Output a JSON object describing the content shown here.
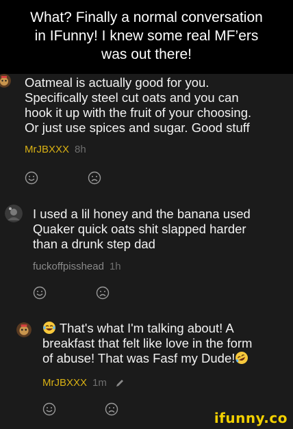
{
  "caption": {
    "lines": [
      "What? Finally a normal conversation",
      "in IFunny! I knew some real MF’ers",
      "was out there!"
    ]
  },
  "comments": [
    {
      "lines": [
        "Oatmeal is actually good for you.",
        "Specifically steel cut oats and you can",
        "hook it up with the fruit of your choosing.",
        "Or just use spices and sugar. Good stuff"
      ],
      "author": "MrJBXXX",
      "time": "8h",
      "avatar_icon": "bear-avatar-icon"
    },
    {
      "lines": [
        "I used a lil honey and the banana used",
        "Quaker quick oats shit slapped harder",
        "than a drunk step dad"
      ],
      "author": "fuckoffpisshead",
      "time": "1h",
      "avatar_icon": "dark-avatar-icon"
    },
    {
      "lines": [
        "That's what I'm talking about! A",
        "breakfast that felt like love in the form",
        "of abuse! That was Fasf my Dude!"
      ],
      "author": "MrJBXXX",
      "time": "1m",
      "avatar_icon": "bear-avatar-icon",
      "leading_emoji": "laughing-tears-emoji",
      "trailing_emoji": "rofl-emoji"
    }
  ],
  "watermark": "ifunny.co",
  "colors": {
    "author_gold": "#d9b114",
    "author_gray": "#8a8a8a",
    "watermark": "#f2d000"
  }
}
